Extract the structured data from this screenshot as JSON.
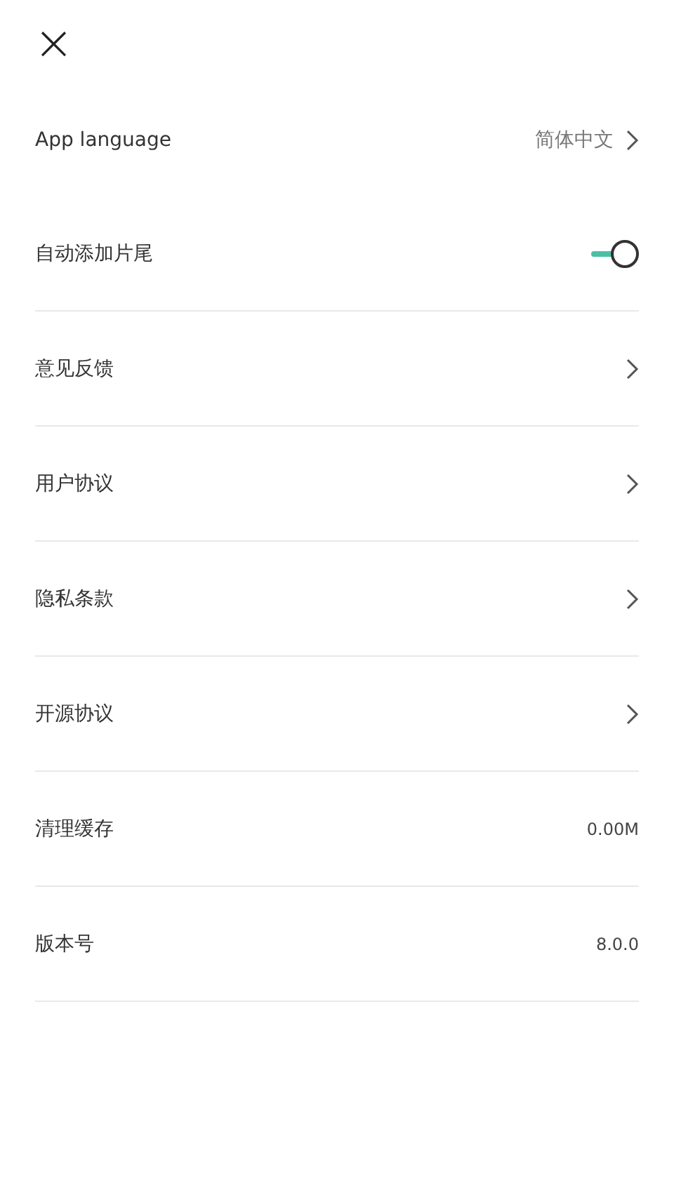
{
  "close_button": {
    "glyph": "×"
  },
  "settings": [
    {
      "kind": "nav",
      "label": "App language",
      "value": "简体中文"
    },
    {
      "kind": "toggle",
      "label": "自动添加片尾",
      "on": true
    },
    {
      "kind": "nav",
      "label": "意见反馈"
    },
    {
      "kind": "nav",
      "label": "用户协议"
    },
    {
      "kind": "nav",
      "label": "隐私条款"
    },
    {
      "kind": "nav",
      "label": "开源协议"
    },
    {
      "kind": "value",
      "label": "清理缓存",
      "value": "0.00M"
    },
    {
      "kind": "value",
      "label": "版本号",
      "value": "8.0.0"
    }
  ]
}
